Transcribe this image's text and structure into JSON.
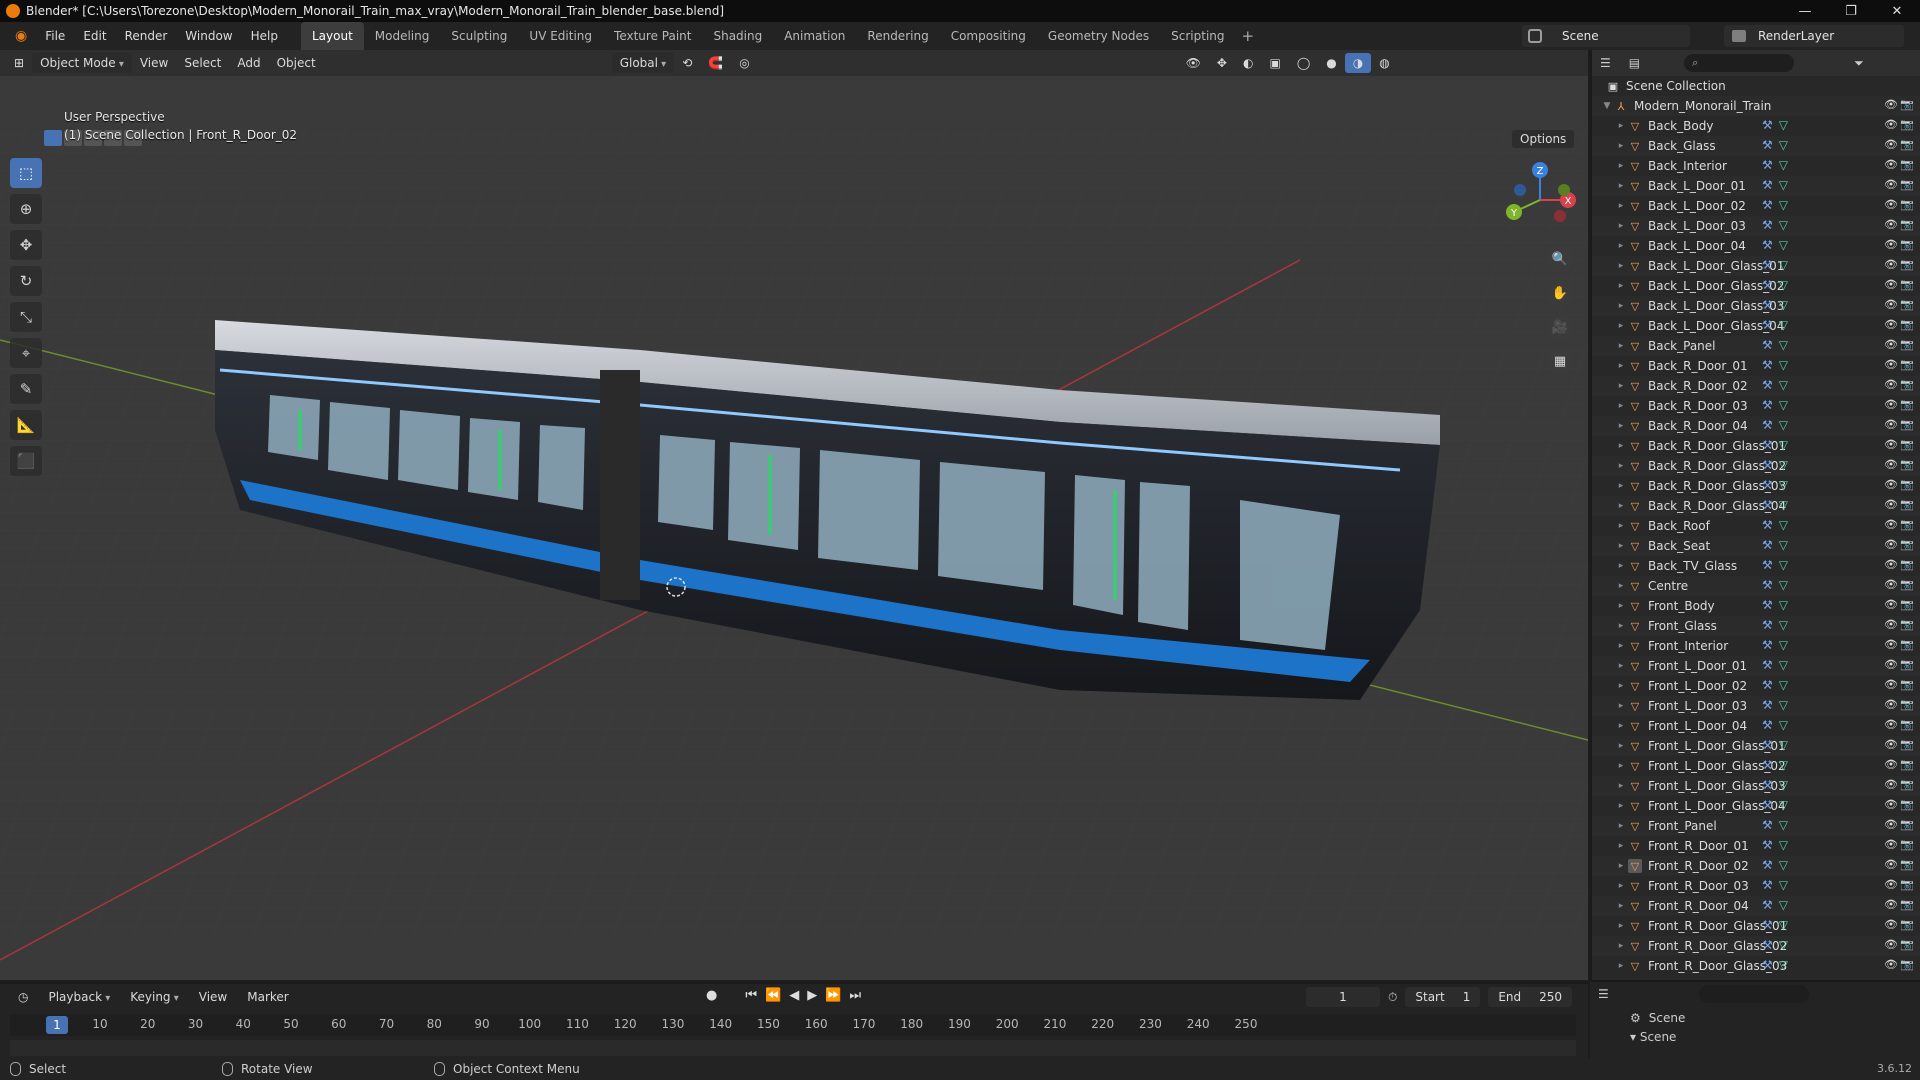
{
  "window": {
    "title": "Blender* [C:\\Users\\Torezone\\Desktop\\Modern_Monorail_Train_max_vray\\Modern_Monorail_Train_blender_base.blend]",
    "controls": [
      "—",
      "❐",
      "✕"
    ]
  },
  "menu": [
    "File",
    "Edit",
    "Render",
    "Window",
    "Help"
  ],
  "workspaces": [
    "Layout",
    "Modeling",
    "Sculpting",
    "UV Editing",
    "Texture Paint",
    "Shading",
    "Animation",
    "Rendering",
    "Compositing",
    "Geometry Nodes",
    "Scripting"
  ],
  "active_workspace": "Layout",
  "scene": {
    "label": "Scene",
    "render_layer": "RenderLayer"
  },
  "viewport": {
    "mode": "Object Mode",
    "menus": [
      "View",
      "Select",
      "Add",
      "Object"
    ],
    "orientation": "Global",
    "options_label": "Options",
    "perspective": "User Perspective",
    "context": "(1) Scene Collection | Front_R_Door_02",
    "gizmo": {
      "x": "X",
      "y": "Y",
      "z": "Z"
    }
  },
  "outliner": {
    "root": "Scene Collection",
    "collection": "Modern_Monorail_Train",
    "selected": "Front_R_Door_02",
    "items": [
      "Back_Body",
      "Back_Glass",
      "Back_Interior",
      "Back_L_Door_01",
      "Back_L_Door_02",
      "Back_L_Door_03",
      "Back_L_Door_04",
      "Back_L_Door_Glass_01",
      "Back_L_Door_Glass_02",
      "Back_L_Door_Glass_03",
      "Back_L_Door_Glass_04",
      "Back_Panel",
      "Back_R_Door_01",
      "Back_R_Door_02",
      "Back_R_Door_03",
      "Back_R_Door_04",
      "Back_R_Door_Glass_01",
      "Back_R_Door_Glass_02",
      "Back_R_Door_Glass_03",
      "Back_R_Door_Glass_04",
      "Back_Roof",
      "Back_Seat",
      "Back_TV_Glass",
      "Centre",
      "Front_Body",
      "Front_Glass",
      "Front_Interior",
      "Front_L_Door_01",
      "Front_L_Door_02",
      "Front_L_Door_03",
      "Front_L_Door_04",
      "Front_L_Door_Glass_01",
      "Front_L_Door_Glass_02",
      "Front_L_Door_Glass_03",
      "Front_L_Door_Glass_04",
      "Front_Panel",
      "Front_R_Door_01",
      "Front_R_Door_02",
      "Front_R_Door_03",
      "Front_R_Door_04",
      "Front_R_Door_Glass_01",
      "Front_R_Door_Glass_02",
      "Front_R_Door_Glass_03"
    ]
  },
  "timeline": {
    "menus": [
      "Playback",
      "Keying",
      "View",
      "Marker"
    ],
    "current_frame": "1",
    "start_label": "Start",
    "start": "1",
    "end_label": "End",
    "end": "250",
    "ticks": [
      "1",
      "10",
      "20",
      "30",
      "40",
      "50",
      "60",
      "70",
      "80",
      "90",
      "100",
      "110",
      "120",
      "130",
      "140",
      "150",
      "160",
      "170",
      "180",
      "190",
      "200",
      "210",
      "220",
      "230",
      "240",
      "250"
    ]
  },
  "properties": {
    "scene": "Scene",
    "section": "Scene"
  },
  "status": {
    "select": "Select",
    "rotate": "Rotate View",
    "context_menu": "Object Context Menu",
    "version": "3.6.12"
  },
  "colors": {
    "accent": "#4772b3",
    "object_orange": "#f0a048",
    "x_axis": "#d8424a",
    "y_axis": "#7fb52c",
    "z_axis": "#3b82e0",
    "train_blue": "#1d73c8"
  }
}
